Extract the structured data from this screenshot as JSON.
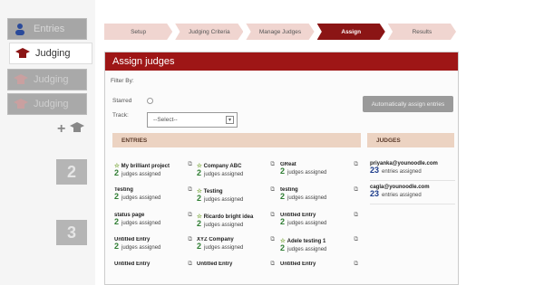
{
  "sidebar": {
    "entries_label": "Entries",
    "judging_items": [
      {
        "label": "Judging",
        "state": "active"
      },
      {
        "label": "Judging",
        "state": "dim"
      },
      {
        "label": "Judging",
        "state": "dim"
      }
    ],
    "add_symbol": "+",
    "step_numbers": [
      "2",
      "3"
    ]
  },
  "wizard": {
    "steps": [
      {
        "label": "Setup",
        "active": false
      },
      {
        "label": "Judging Criteria",
        "active": false
      },
      {
        "label": "Manage Judges",
        "active": false
      },
      {
        "label": "Assign",
        "active": true
      },
      {
        "label": "Results",
        "active": false
      }
    ]
  },
  "panel": {
    "title": "Assign judges",
    "filter_by": "Filter By:",
    "starred_label": "Starred",
    "track_label": "Track:",
    "track_select_value": "--Select--",
    "auto_assign_label": "Automatically assign entries",
    "entries_header": "ENTRIES",
    "judges_header": "JUDGES"
  },
  "entries": [
    {
      "name": "My brilliant project",
      "starred": true,
      "count": "2",
      "suffix": "judges assigned"
    },
    {
      "name": "Company ABC",
      "starred": true,
      "count": "2",
      "suffix": "judges assigned"
    },
    {
      "name": "GReat",
      "starred": false,
      "count": "2",
      "suffix": "judges assigned"
    },
    {
      "name": "Testing",
      "starred": false,
      "count": "2",
      "suffix": "judges assigned"
    },
    {
      "name": "Testing",
      "starred": true,
      "count": "2",
      "suffix": "judges assigned"
    },
    {
      "name": "testing",
      "starred": false,
      "count": "2",
      "suffix": "judges assigned"
    },
    {
      "name": "status page",
      "starred": false,
      "count": "2",
      "suffix": "judges assigned"
    },
    {
      "name": "Ricardo bright idea",
      "starred": true,
      "count": "2",
      "suffix": "judges assigned"
    },
    {
      "name": "Untitled Entry",
      "starred": false,
      "count": "2",
      "suffix": "judges assigned"
    },
    {
      "name": "Untitled Entry",
      "starred": false,
      "count": "2",
      "suffix": "judges assigned"
    },
    {
      "name": "XYZ Company",
      "starred": false,
      "count": "2",
      "suffix": "judges assigned"
    },
    {
      "name": "Adele testing 1",
      "starred": true,
      "count": "2",
      "suffix": "judges assigned"
    },
    {
      "name": "Untitled Entry",
      "starred": false,
      "count": "",
      "suffix": ""
    },
    {
      "name": "Untitled Entry",
      "starred": false,
      "count": "",
      "suffix": ""
    },
    {
      "name": "Untitled Entry",
      "starred": false,
      "count": "",
      "suffix": ""
    }
  ],
  "judges": [
    {
      "email": "priyanka@younoodle.com",
      "count": "23",
      "suffix": "entries assigned"
    },
    {
      "email": "cagla@younoodle.com",
      "count": "23",
      "suffix": "entries assigned"
    }
  ],
  "icons": {
    "entries": "person-icon",
    "judging": "graduation-cap-icon",
    "star": "star-icon",
    "edit": "external-edit-icon"
  },
  "colors": {
    "brand_red": "#9e1616",
    "active_step": "#8b1515",
    "section_header": "#ecd3c2",
    "count_green": "#2e7d32",
    "count_blue": "#1a3a8a"
  }
}
